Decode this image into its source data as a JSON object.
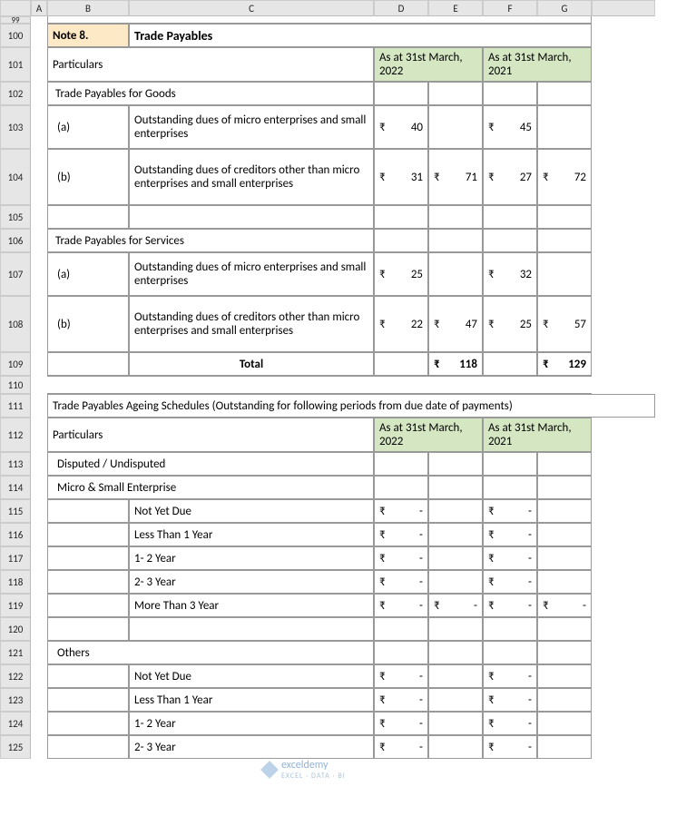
{
  "cols": [
    "A",
    "B",
    "C",
    "D",
    "E",
    "F",
    "G"
  ],
  "rows": [
    "99",
    "100",
    "101",
    "102",
    "103",
    "104",
    "105",
    "106",
    "107",
    "108",
    "109",
    "110",
    "111",
    "112",
    "113",
    "114",
    "115",
    "116",
    "117",
    "118",
    "119",
    "120",
    "121",
    "122",
    "123",
    "124",
    "125"
  ],
  "note": "Note 8.",
  "title": "Trade Payables",
  "particulars": "Particulars",
  "date2022": "As at 31st March, 2022",
  "date2021": "As at 31st March, 2021",
  "section_goods": "Trade Payables for Goods",
  "section_services": "Trade Payables for Services",
  "row_a_label": "(a)",
  "row_b_label": "(b)",
  "desc_micro": "Outstanding dues of micro enterprises and small enterprises",
  "desc_other": "Outstanding dues of creditors other than micro enterprises and small enterprises",
  "goods": {
    "a_2022": "40",
    "b_2022": "31",
    "sub_2022": "71",
    "a_2021": "45",
    "b_2021": "27",
    "sub_2021": "72"
  },
  "services": {
    "a_2022": "25",
    "b_2022": "22",
    "sub_2022": "47",
    "a_2021": "32",
    "b_2021": "25",
    "sub_2021": "57"
  },
  "total_label": "Total",
  "total_2022": "118",
  "total_2021": "129",
  "ageing_title": "Trade Payables Ageing Schedules (Outstanding for following periods from due date of payments)",
  "disputed": "Disputed / Undisputed",
  "mse": "Micro & Small Enterprise",
  "others": "Others",
  "periods": [
    "Not Yet Due",
    "Less Than 1 Year",
    "1- 2 Year",
    "2- 3 Year",
    "More Than 3 Year"
  ],
  "dash": "-",
  "watermark": {
    "brand": "exceldemy",
    "tag": "EXCEL · DATA · BI"
  }
}
